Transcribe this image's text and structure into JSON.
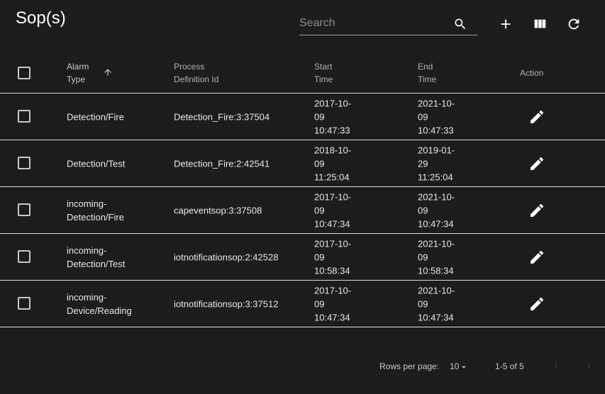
{
  "header": {
    "title": "Sop(s)",
    "search_placeholder": "Search"
  },
  "toolbar": {
    "icons": [
      "search-icon",
      "add-icon",
      "view-column-icon",
      "refresh-icon"
    ]
  },
  "table": {
    "columns": [
      {
        "line1": "Alarm",
        "line2": "Type",
        "sorted": "ascending"
      },
      {
        "line1": "Process",
        "line2": "Definition Id"
      },
      {
        "line1": "Start",
        "line2": "Time"
      },
      {
        "line1": "End",
        "line2": "Time"
      },
      {
        "line1": "Action",
        "line2": ""
      }
    ],
    "rows": [
      {
        "alarm1": "Detection/Fire",
        "alarm2": "",
        "process": "Detection_Fire:3:37504",
        "start1": "2017-10-",
        "start2": "09",
        "start3": "10:47:33",
        "end1": "2021-10-",
        "end2": "09",
        "end3": "10:47:33"
      },
      {
        "alarm1": "Detection/Test",
        "alarm2": "",
        "process": "Detection_Fire:2:42541",
        "start1": "2018-10-",
        "start2": "09",
        "start3": "11:25:04",
        "end1": "2019-01-",
        "end2": "29",
        "end3": "11:25:04"
      },
      {
        "alarm1": "incoming-",
        "alarm2": "Detection/Fire",
        "process": "capeventsop:3:37508",
        "start1": "2017-10-",
        "start2": "09",
        "start3": "10:47:34",
        "end1": "2021-10-",
        "end2": "09",
        "end3": "10:47:34"
      },
      {
        "alarm1": "incoming-",
        "alarm2": "Detection/Test",
        "process": "iotnotificationsop:2:42528",
        "start1": "2017-10-",
        "start2": "09",
        "start3": "10:58:34",
        "end1": "2021-10-",
        "end2": "09",
        "end3": "10:58:34"
      },
      {
        "alarm1": "incoming-",
        "alarm2": "Device/Reading",
        "process": "iotnotificationsop:3:37512",
        "start1": "2017-10-",
        "start2": "09",
        "start3": "10:47:34",
        "end1": "2021-10-",
        "end2": "09",
        "end3": "10:47:34"
      }
    ]
  },
  "footer": {
    "rows_per_page_label": "Rows per page:",
    "rows_per_page_value": "10",
    "range": "1-5 of 5"
  },
  "colors": {
    "background": "#1c1c1c",
    "divider": "#dcdcdc",
    "text": "#e8e8e8",
    "muted": "#b0b0b0"
  }
}
